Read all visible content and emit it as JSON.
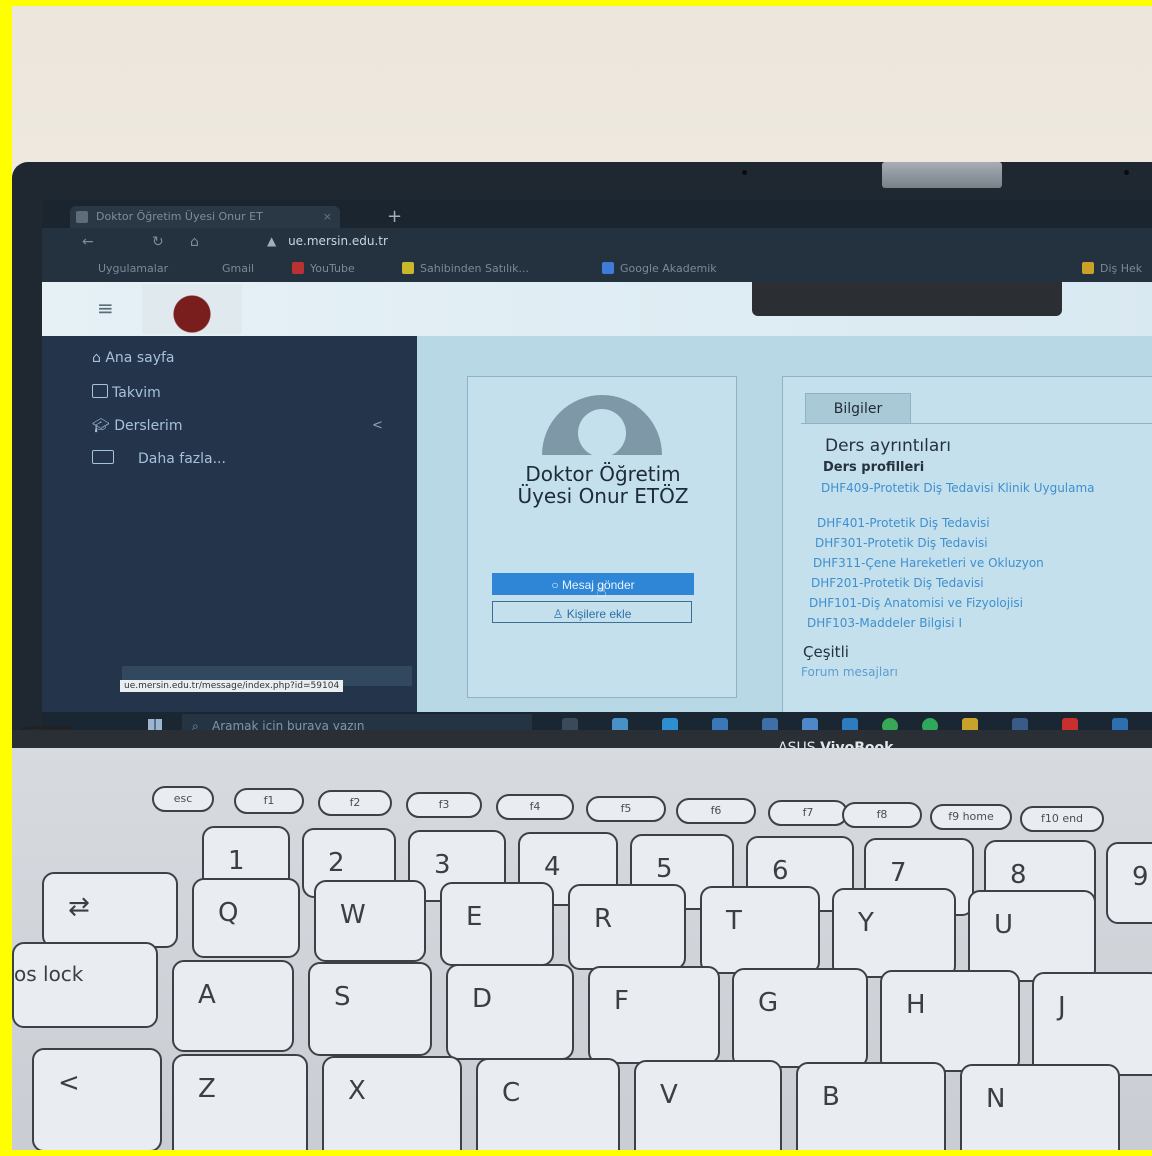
{
  "browser": {
    "tab_title": "Doktor Öğretim Üyesi Onur ET",
    "tab_close": "×",
    "new_tab": "+",
    "url_domain": "ue.mersin.edu.tr",
    "bookmarks": [
      {
        "label": "Uygulamalar"
      },
      {
        "label": "Gmail"
      },
      {
        "label": "YouTube"
      },
      {
        "label": "Sahibinden Satılık..."
      },
      {
        "label": "Google Akademik"
      },
      {
        "label": "Diş Hek"
      }
    ]
  },
  "sidebar": {
    "items": [
      {
        "label": "Ana sayfa",
        "icon": "home-icon"
      },
      {
        "label": "Takvim",
        "icon": "calendar-icon"
      },
      {
        "label": "Derslerim",
        "icon": "graduation-cap-icon"
      },
      {
        "label": "Daha fazla...",
        "icon": "folder-icon"
      }
    ],
    "collapse": "<",
    "status_url": "ue.mersin.edu.tr/message/index.php?id=59104"
  },
  "profile": {
    "name": "Doktor Öğretim Üyesi Onur ETÖZ",
    "message_button": "Mesaj gönder",
    "add_contact_button": "Kişilere ekle"
  },
  "details": {
    "tab": "Bilgiler",
    "section_title": "Ders ayrıntıları",
    "subsection": "Ders profilleri",
    "courses": [
      "DHF409-Protetik Diş Tedavisi Klinik Uygulama",
      "DHF401-Protetik Diş Tedavisi",
      "DHF301-Protetik Diş Tedavisi",
      "DHF311-Çene Hareketleri ve Okluzyon",
      "DHF201-Protetik Diş Tedavisi",
      "DHF101-Diş Anatomisi ve Fizyolojisi",
      "DHF103-Maddeler Bilgisi I"
    ],
    "misc_title": "Çeşitli",
    "misc_link": "Forum mesajları"
  },
  "taskbar": {
    "search_placeholder": "Aramak için buraya yazın"
  },
  "laptop": {
    "brand": "ASUS",
    "model": "VivoBook"
  },
  "keyboard": {
    "fn_row": [
      "esc",
      "f1",
      "f2",
      "f3",
      "f4",
      "f5",
      "f6",
      "f7",
      "f8",
      "f9 home",
      "f10 end"
    ],
    "number_row": [
      "1",
      "2",
      "3",
      "4",
      "5",
      "6",
      "7",
      "8",
      "9"
    ],
    "q_row": [
      "Q",
      "W",
      "E",
      "R",
      "T",
      "Y",
      "U"
    ],
    "a_row": [
      "A",
      "S",
      "D",
      "F",
      "G",
      "H",
      "J"
    ],
    "z_row": [
      "Z",
      "X",
      "C",
      "V",
      "B",
      "N"
    ],
    "caps_label": "os lock"
  },
  "colors": {
    "border_frame": "#ffff00",
    "message_button": "#2f86d6",
    "course_link": "#3f8fcf"
  }
}
